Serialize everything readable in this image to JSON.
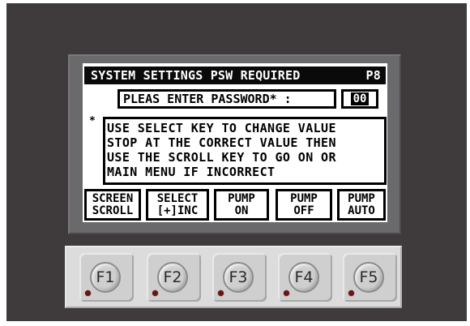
{
  "screen": {
    "title": "SYSTEM SETTINGS PSW REQUIRED",
    "page": "P8",
    "prompt": "PLEAS ENTER PASSWORD* :",
    "password_value": "00",
    "asterisk": "*",
    "message_lines": [
      "USE SELECT KEY TO CHANGE VALUE",
      "STOP AT THE CORRECT VALUE THEN",
      "USE THE SCROLL KEY TO GO ON OR",
      "MAIN MENU IF INCORRECT"
    ]
  },
  "softkeys": [
    {
      "line1": "SCREEN",
      "line2": "SCROLL"
    },
    {
      "line1": "SELECT",
      "line2": "[+]INC"
    },
    {
      "line1": "PUMP",
      "line2": "ON"
    },
    {
      "line1": "PUMP",
      "line2": "OFF"
    },
    {
      "line1": "PUMP",
      "line2": "AUTO"
    }
  ],
  "function_keys": [
    "F1",
    "F2",
    "F3",
    "F4",
    "F5"
  ],
  "colors": {
    "panel": "#3f3a3b",
    "bezel": "#6a6a6c",
    "lcd": "#ffffff",
    "ink": "#0a0a0a",
    "keypad": "#dcdcdc",
    "led": "#6b1414"
  }
}
